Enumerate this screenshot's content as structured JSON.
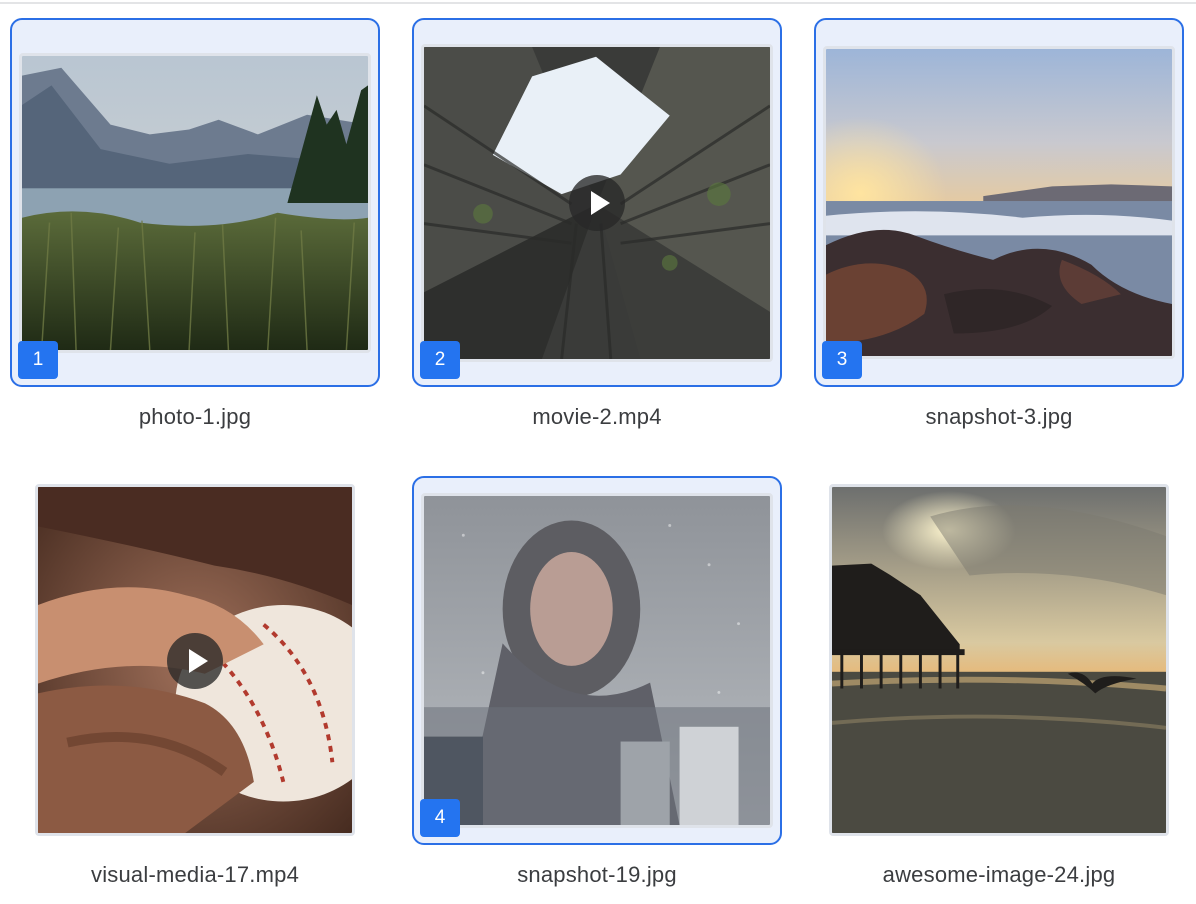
{
  "gallery": {
    "items": [
      {
        "filename": "photo-1.jpg",
        "selected": true,
        "selection_index": "1",
        "is_video": false,
        "scene": "lake-mountains-reeds"
      },
      {
        "filename": "movie-2.mp4",
        "selected": true,
        "selection_index": "2",
        "is_video": true,
        "scene": "building-looking-up"
      },
      {
        "filename": "snapshot-3.jpg",
        "selected": true,
        "selection_index": "3",
        "is_video": false,
        "scene": "rocky-shore-sunset"
      },
      {
        "filename": "visual-media-17.mp4",
        "selected": false,
        "selection_index": "",
        "is_video": true,
        "scene": "baseball-glove"
      },
      {
        "filename": "snapshot-19.jpg",
        "selected": true,
        "selection_index": "4",
        "is_video": false,
        "scene": "woman-rainy-window"
      },
      {
        "filename": "awesome-image-24.jpg",
        "selected": false,
        "selection_index": "",
        "is_video": false,
        "scene": "pier-sunset-bird"
      }
    ]
  },
  "colors": {
    "selection_accent": "#2b6fe6",
    "selection_fill": "#e9effb",
    "badge": "#2474f0",
    "caption_text": "#3b3d40"
  }
}
